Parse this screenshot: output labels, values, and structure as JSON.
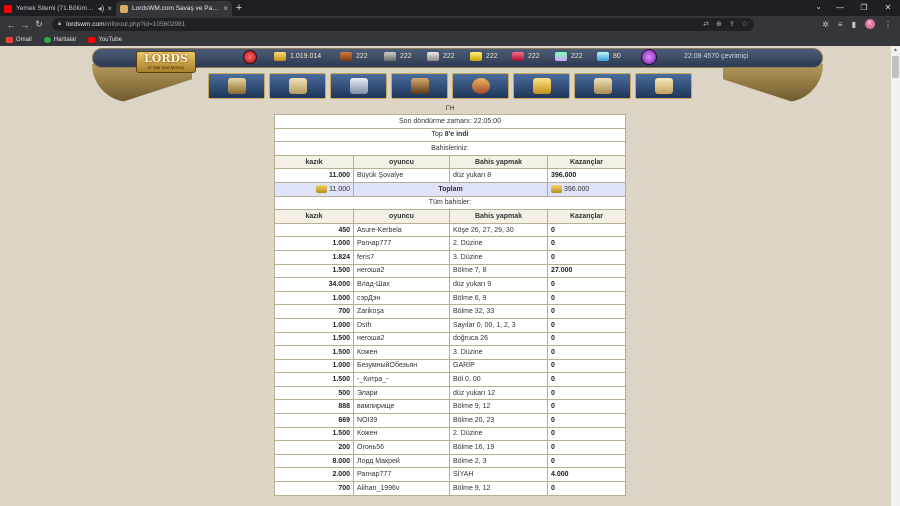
{
  "browser": {
    "tabs": [
      {
        "title": "Yemek Sitemi (71.Bölüm) - Ç",
        "favicon_color": "#ff0000"
      },
      {
        "title": "LordsWM.com Savaş ve Para Lo",
        "favicon_color": "#d8b060"
      }
    ],
    "address": {
      "domain": "lordswm.com",
      "path": "/inforoul.php?id=105602981"
    },
    "profile_initial": "K",
    "bookmarks": [
      "Gmail",
      "Haritalar",
      "YouTube"
    ]
  },
  "game": {
    "logo_big": "LORDS",
    "logo_small": "of War and Money",
    "resources": {
      "gold": "1.019.014",
      "wood": "222",
      "ore": "222",
      "mercury": "222",
      "sulfur": "222",
      "crystals": "222",
      "gems": "222",
      "diamonds": "80"
    },
    "status": "22:08  4570 çevrimiçi",
    "nav_icons": [
      "shield-icon",
      "scroll-map-icon",
      "crossed-swords-icon",
      "portrait-icon",
      "round-table-icon",
      "stars-icon",
      "quill-scroll-icon",
      "chat-bubble-icon"
    ]
  },
  "roulette": {
    "gh": "ГН",
    "spin_time": "Son döndürme zamanı: 22:05:00",
    "top_label": "Top",
    "top_value": "8'e indi",
    "your_bets_label": "Bahisleriniz:",
    "headers": [
      "kazık",
      "oyuncu",
      "Bahis yapmak",
      "Kazançlar"
    ],
    "your_bet": {
      "stake": "11.000",
      "player": "Büyük Şovalye",
      "bet": "düz yukarı 8",
      "win": "396.000"
    },
    "total": {
      "stake": "11.000",
      "label": "Toplam",
      "win": "396.000"
    },
    "all_bets_label": "Tüm bahisler:",
    "all_bets": [
      {
        "stake": "450",
        "player": "Asure-Kerbela",
        "bet": "Köşe 26, 27, 29, 30",
        "win": "0"
      },
      {
        "stake": "1.000",
        "player": "Рагнар777",
        "bet": "2. Düzine",
        "win": "0"
      },
      {
        "stake": "1.824",
        "player": "feris7",
        "bet": "3. Düzine",
        "win": "0"
      },
      {
        "stake": "1.500",
        "player": "негоша2",
        "bet": "Bölme 7, 8",
        "win": "27.000"
      },
      {
        "stake": "34.000",
        "player": "Влад-Шах",
        "bet": "düz yukarı 9",
        "win": "0"
      },
      {
        "stake": "1.000",
        "player": "сэрДэн",
        "bet": "Bölme 6, 9",
        "win": "0"
      },
      {
        "stake": "700",
        "player": "Zarikoşa",
        "bet": "Bölme 32, 33",
        "win": "0"
      },
      {
        "stake": "1.000",
        "player": "Dsth",
        "bet": "Sayılar 0, 00, 1, 2, 3",
        "win": "0"
      },
      {
        "stake": "1.500",
        "player": "негоша2",
        "bet": "doğruca 26",
        "win": "0"
      },
      {
        "stake": "1.500",
        "player": "Кожен",
        "bet": "3. Düzine",
        "win": "0"
      },
      {
        "stake": "1.000",
        "player": "БезумныйОбезьян",
        "bet": "GARİP",
        "win": "0"
      },
      {
        "stake": "1.500",
        "player": "-_Китра_-",
        "bet": "Böl 0, 00",
        "win": "0"
      },
      {
        "stake": "500",
        "player": "Элари",
        "bet": "düz yukarı 12",
        "win": "0"
      },
      {
        "stake": "888",
        "player": "вампирище",
        "bet": "Bölme 9, 12",
        "win": "0"
      },
      {
        "stake": "669",
        "player": "NOI39",
        "bet": "Bölme 20, 23",
        "win": "0"
      },
      {
        "stake": "1.500",
        "player": "Кожен",
        "bet": "2. Düzine",
        "win": "0"
      },
      {
        "stake": "200",
        "player": "Огонь56",
        "bet": "Bölme 16, 19",
        "win": "0"
      },
      {
        "stake": "8.000",
        "player": "Лорд Макрей",
        "bet": "Bölme 2, 3",
        "win": "0"
      },
      {
        "stake": "2.000",
        "player": "Рагнар777",
        "bet": "SİYAH",
        "win": "4.000"
      },
      {
        "stake": "700",
        "player": "Alihan_1996v",
        "bet": "Bölme 9, 12",
        "win": "0"
      }
    ]
  }
}
